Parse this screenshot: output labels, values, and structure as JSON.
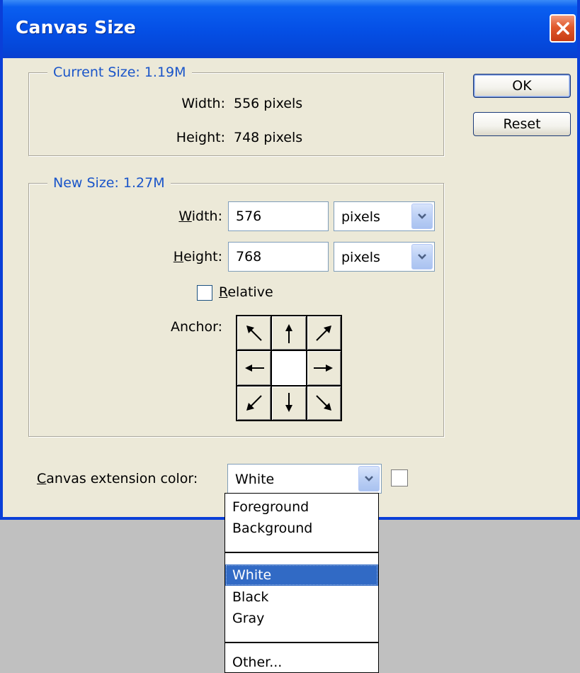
{
  "window": {
    "title": "Canvas Size"
  },
  "current_size": {
    "legend": "Current Size: 1.19M",
    "width_label": "Width:",
    "width_value": "556 pixels",
    "height_label": "Height:",
    "height_value": "748 pixels"
  },
  "new_size": {
    "legend": "New Size: 1.27M",
    "width_label_mnemonic": "W",
    "width_label_rest": "idth:",
    "width_value": "576",
    "width_unit": "pixels",
    "height_label_mnemonic": "H",
    "height_label_rest": "eight:",
    "height_value": "768",
    "height_unit": "pixels",
    "relative_label_mnemonic": "R",
    "relative_label_rest": "elative",
    "relative_checked": false,
    "anchor_label": "Anchor:"
  },
  "buttons": {
    "ok": "OK",
    "reset": "Reset"
  },
  "extension": {
    "label_mnemonic": "C",
    "label_rest": "anvas extension color:",
    "selected": "White",
    "swatch_color": "#ffffff"
  },
  "dropdown": {
    "group1": [
      "Foreground",
      "Background"
    ],
    "group2": [
      "White",
      "Black",
      "Gray"
    ],
    "group3": [
      "Other..."
    ],
    "highlighted": "White"
  },
  "colors": {
    "titlebar": "#0550e6",
    "legend_text": "#1a55c9",
    "highlight": "#316ac5",
    "dialog_bg": "#ece9d8"
  }
}
